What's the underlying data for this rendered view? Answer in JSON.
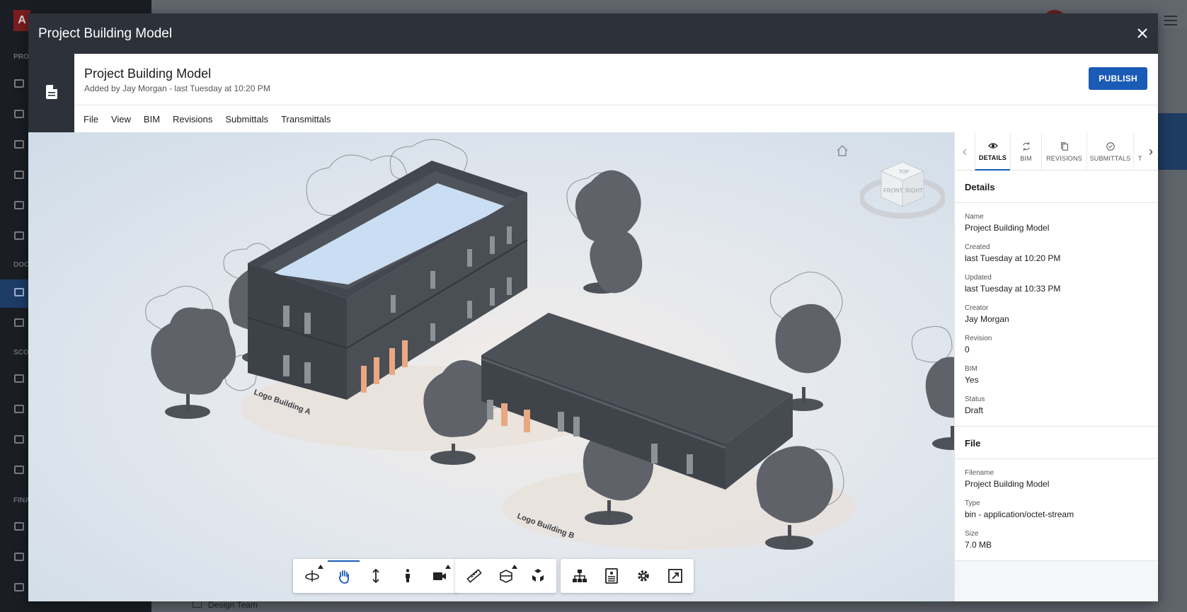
{
  "background": {
    "logo": "A",
    "sections": [
      "PRO",
      "DOC",
      "SCO",
      "FINA"
    ],
    "bottom_item": "Design Team"
  },
  "modal": {
    "title": "Project Building Model",
    "close_icon": "close-icon"
  },
  "document": {
    "icon": "document-icon",
    "title": "Project Building Model",
    "subtitle": "Added by Jay Morgan - last Tuesday at 10:20 PM",
    "publish_label": "PUBLISH"
  },
  "menu": [
    "File",
    "View",
    "BIM",
    "Revisions",
    "Submittals",
    "Transmittals"
  ],
  "viewer": {
    "viewcube": {
      "top": "TOP",
      "front": "FRONT",
      "right": "RIGHT"
    },
    "labels": [
      "Logo Building A",
      "Logo Building B"
    ],
    "toolbar": [
      [
        "orbit-icon",
        "pan-icon",
        "dolly-icon",
        "first-person-icon",
        "camera-icon"
      ],
      [
        "measure-icon",
        "section-icon",
        "explode-icon"
      ],
      [
        "model-browser-icon",
        "properties-icon",
        "settings-icon",
        "fullscreen-icon"
      ]
    ]
  },
  "panel": {
    "tabs": [
      {
        "label": "DETAILS",
        "icon": "eye-icon"
      },
      {
        "label": "BIM",
        "icon": "sync-icon"
      },
      {
        "label": "REVISIONS",
        "icon": "copy-icon"
      },
      {
        "label": "SUBMITTALS",
        "icon": "check-circle-icon"
      },
      {
        "label": "T",
        "icon": ""
      }
    ],
    "details": {
      "title": "Details",
      "fields": [
        {
          "label": "Name",
          "value": "Project Building Model"
        },
        {
          "label": "Created",
          "value": "last Tuesday at 10:20 PM"
        },
        {
          "label": "Updated",
          "value": "last Tuesday at 10:33 PM"
        },
        {
          "label": "Creator",
          "value": "Jay Morgan"
        },
        {
          "label": "Revision",
          "value": "0"
        },
        {
          "label": "BIM",
          "value": "Yes"
        },
        {
          "label": "Status",
          "value": "Draft"
        }
      ]
    },
    "file": {
      "title": "File",
      "fields": [
        {
          "label": "Filename",
          "value": "Project Building Model"
        },
        {
          "label": "Type",
          "value": "bin - application/octet-stream"
        },
        {
          "label": "Size",
          "value": "7.0 MB"
        }
      ]
    }
  },
  "colors": {
    "accent": "#1a5bb6",
    "header": "#2c313a"
  }
}
